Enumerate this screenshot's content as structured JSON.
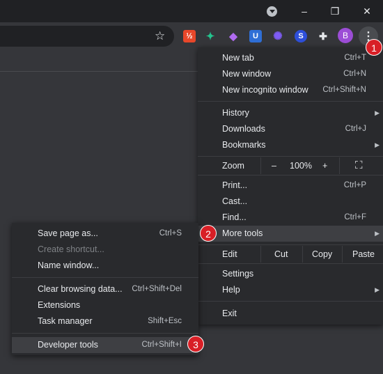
{
  "window": {
    "profile_icon": "chevron-down-icon",
    "minimize": "–",
    "restore": "❐",
    "close": "✕"
  },
  "toolbar": {
    "star": "☆",
    "extensions": [
      {
        "name": "ext-red-icon",
        "glyph": "½",
        "color": "#e8472a"
      },
      {
        "name": "ext-bird-icon",
        "glyph": "✦",
        "color": "#23c48e"
      },
      {
        "name": "ext-purple-icon",
        "glyph": "◆",
        "color": "#b06bf0"
      },
      {
        "name": "ext-shield-icon",
        "glyph": "U",
        "color": "#2f6fd6"
      },
      {
        "name": "ext-gear-icon",
        "glyph": "✺",
        "color": "#7e5cf5"
      },
      {
        "name": "ext-s-icon",
        "glyph": "S",
        "color": "#2e4fd9"
      },
      {
        "name": "puzzle-icon",
        "glyph": "✚",
        "color": "#e8eaed"
      }
    ],
    "avatar": "B",
    "menu_glyph": "⋮"
  },
  "menu": {
    "new_tab": "New tab",
    "new_tab_sc": "Ctrl+T",
    "new_window": "New window",
    "new_window_sc": "Ctrl+N",
    "incognito": "New incognito window",
    "incognito_sc": "Ctrl+Shift+N",
    "history": "History",
    "downloads": "Downloads",
    "downloads_sc": "Ctrl+J",
    "bookmarks": "Bookmarks",
    "zoom": "Zoom",
    "zoom_minus": "–",
    "zoom_value": "100%",
    "zoom_plus": "+",
    "fullscreen": "⛶",
    "print": "Print...",
    "print_sc": "Ctrl+P",
    "cast": "Cast...",
    "find": "Find...",
    "find_sc": "Ctrl+F",
    "more_tools": "More tools",
    "edit": "Edit",
    "cut": "Cut",
    "copy": "Copy",
    "paste": "Paste",
    "settings": "Settings",
    "help": "Help",
    "exit": "Exit",
    "arrow": "▶"
  },
  "submenu": {
    "save_page": "Save page as...",
    "save_page_sc": "Ctrl+S",
    "create_shortcut": "Create shortcut...",
    "name_window": "Name window...",
    "clear_data": "Clear browsing data...",
    "clear_data_sc": "Ctrl+Shift+Del",
    "extensions": "Extensions",
    "task_manager": "Task manager",
    "task_manager_sc": "Shift+Esc",
    "dev_tools": "Developer tools",
    "dev_tools_sc": "Ctrl+Shift+I"
  },
  "badges": [
    "1",
    "2",
    "3"
  ]
}
